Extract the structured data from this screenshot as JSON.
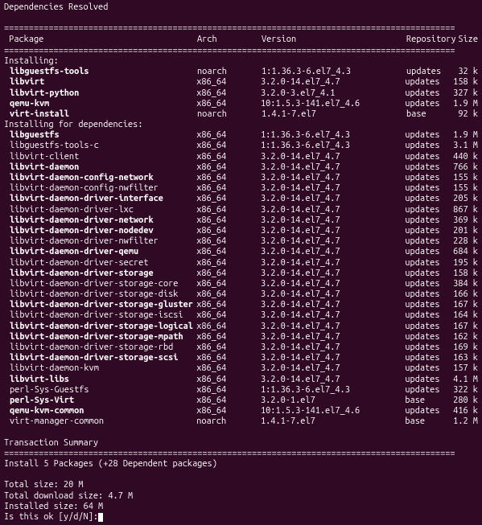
{
  "header_text": "Dependencies Resolved",
  "divider": "===========================================================================================",
  "col_headers": {
    "pkg": " Package",
    "arch": "Arch",
    "ver": "Version",
    "repo": "Repository",
    "size": "Size"
  },
  "section_install": "Installing:",
  "section_deps": "Installing for dependencies:",
  "install": [
    {
      "pkg": "libguestfs-tools",
      "arch": "noarch",
      "ver": "1:1.36.3-6.el7_4.3",
      "repo": "updates",
      "size": "32 k"
    },
    {
      "pkg": "libvirt",
      "arch": "x86_64",
      "ver": "3.2.0-14.el7_4.7",
      "repo": "updates",
      "size": "158 k"
    },
    {
      "pkg": "libvirt-python",
      "arch": "x86_64",
      "ver": "3.2.0-3.el7_4.1",
      "repo": "updates",
      "size": "327 k"
    },
    {
      "pkg": "qemu-kvm",
      "arch": "x86_64",
      "ver": "10:1.5.3-141.el7_4.6",
      "repo": "updates",
      "size": "1.9 M"
    },
    {
      "pkg": "virt-install",
      "arch": "noarch",
      "ver": "1.4.1-7.el7",
      "repo": "base",
      "size": "92 k"
    }
  ],
  "deps": [
    {
      "pkg": "libguestfs",
      "arch": "x86_64",
      "ver": "1:1.36.3-6.el7_4.3",
      "repo": "updates",
      "size": "1.9 M",
      "bold": true
    },
    {
      "pkg": "libguestfs-tools-c",
      "arch": "x86_64",
      "ver": "1:1.36.3-6.el7_4.3",
      "repo": "updates",
      "size": "3.1 M",
      "bold": false
    },
    {
      "pkg": "libvirt-client",
      "arch": "x86_64",
      "ver": "3.2.0-14.el7_4.7",
      "repo": "updates",
      "size": "440 k",
      "bold": false
    },
    {
      "pkg": "libvirt-daemon",
      "arch": "x86_64",
      "ver": "3.2.0-14.el7_4.7",
      "repo": "updates",
      "size": "766 k",
      "bold": true
    },
    {
      "pkg": "libvirt-daemon-config-network",
      "arch": "x86_64",
      "ver": "3.2.0-14.el7_4.7",
      "repo": "updates",
      "size": "155 k",
      "bold": true
    },
    {
      "pkg": "libvirt-daemon-config-nwfilter",
      "arch": "x86_64",
      "ver": "3.2.0-14.el7_4.7",
      "repo": "updates",
      "size": "155 k",
      "bold": false
    },
    {
      "pkg": "libvirt-daemon-driver-interface",
      "arch": "x86_64",
      "ver": "3.2.0-14.el7_4.7",
      "repo": "updates",
      "size": "205 k",
      "bold": true
    },
    {
      "pkg": "libvirt-daemon-driver-lxc",
      "arch": "x86_64",
      "ver": "3.2.0-14.el7_4.7",
      "repo": "updates",
      "size": "867 k",
      "bold": false
    },
    {
      "pkg": "libvirt-daemon-driver-network",
      "arch": "x86_64",
      "ver": "3.2.0-14.el7_4.7",
      "repo": "updates",
      "size": "369 k",
      "bold": true
    },
    {
      "pkg": "libvirt-daemon-driver-nodedev",
      "arch": "x86_64",
      "ver": "3.2.0-14.el7_4.7",
      "repo": "updates",
      "size": "201 k",
      "bold": true
    },
    {
      "pkg": "libvirt-daemon-driver-nwfilter",
      "arch": "x86_64",
      "ver": "3.2.0-14.el7_4.7",
      "repo": "updates",
      "size": "228 k",
      "bold": false
    },
    {
      "pkg": "libvirt-daemon-driver-qemu",
      "arch": "x86_64",
      "ver": "3.2.0-14.el7_4.7",
      "repo": "updates",
      "size": "684 k",
      "bold": true
    },
    {
      "pkg": "libvirt-daemon-driver-secret",
      "arch": "x86_64",
      "ver": "3.2.0-14.el7_4.7",
      "repo": "updates",
      "size": "195 k",
      "bold": false
    },
    {
      "pkg": "libvirt-daemon-driver-storage",
      "arch": "x86_64",
      "ver": "3.2.0-14.el7_4.7",
      "repo": "updates",
      "size": "158 k",
      "bold": true
    },
    {
      "pkg": "libvirt-daemon-driver-storage-core",
      "arch": "x86_64",
      "ver": "3.2.0-14.el7_4.7",
      "repo": "updates",
      "size": "384 k",
      "bold": false
    },
    {
      "pkg": "libvirt-daemon-driver-storage-disk",
      "arch": "x86_64",
      "ver": "3.2.0-14.el7_4.7",
      "repo": "updates",
      "size": "166 k",
      "bold": false
    },
    {
      "pkg": "libvirt-daemon-driver-storage-gluster",
      "arch": "x86_64",
      "ver": "3.2.0-14.el7_4.7",
      "repo": "updates",
      "size": "167 k",
      "bold": true
    },
    {
      "pkg": "libvirt-daemon-driver-storage-iscsi",
      "arch": "x86_64",
      "ver": "3.2.0-14.el7_4.7",
      "repo": "updates",
      "size": "164 k",
      "bold": false
    },
    {
      "pkg": "libvirt-daemon-driver-storage-logical",
      "arch": "x86_64",
      "ver": "3.2.0-14.el7_4.7",
      "repo": "updates",
      "size": "167 k",
      "bold": true
    },
    {
      "pkg": "libvirt-daemon-driver-storage-mpath",
      "arch": "x86_64",
      "ver": "3.2.0-14.el7_4.7",
      "repo": "updates",
      "size": "162 k",
      "bold": true
    },
    {
      "pkg": "libvirt-daemon-driver-storage-rbd",
      "arch": "x86_64",
      "ver": "3.2.0-14.el7_4.7",
      "repo": "updates",
      "size": "169 k",
      "bold": false
    },
    {
      "pkg": "libvirt-daemon-driver-storage-scsi",
      "arch": "x86_64",
      "ver": "3.2.0-14.el7_4.7",
      "repo": "updates",
      "size": "163 k",
      "bold": true
    },
    {
      "pkg": "libvirt-daemon-kvm",
      "arch": "x86_64",
      "ver": "3.2.0-14.el7_4.7",
      "repo": "updates",
      "size": "157 k",
      "bold": false
    },
    {
      "pkg": "libvirt-libs",
      "arch": "x86_64",
      "ver": "3.2.0-14.el7_4.7",
      "repo": "updates",
      "size": "4.1 M",
      "bold": true
    },
    {
      "pkg": "perl-Sys-Guestfs",
      "arch": "x86_64",
      "ver": "1:1.36.3-6.el7_4.3",
      "repo": "updates",
      "size": "322 k",
      "bold": false
    },
    {
      "pkg": "perl-Sys-Virt",
      "arch": "x86_64",
      "ver": "3.2.0-1.el7",
      "repo": "base",
      "size": "280 k",
      "bold": true
    },
    {
      "pkg": "qemu-kvm-common",
      "arch": "x86_64",
      "ver": "10:1.5.3-141.el7_4.6",
      "repo": "updates",
      "size": "416 k",
      "bold": true
    },
    {
      "pkg": "virt-manager-common",
      "arch": "noarch",
      "ver": "1.4.1-7.el7",
      "repo": "base",
      "size": "1.2 M",
      "bold": false
    }
  ],
  "summary_header": "Transaction Summary",
  "summary_line": "Install  5 Packages (+28 Dependent packages)",
  "total_size": "Total size: 20 M",
  "total_download": "Total download size: 4.7 M",
  "installed_size": "Installed size: 64 M",
  "prompt": "Is this ok [y/d/N]: "
}
